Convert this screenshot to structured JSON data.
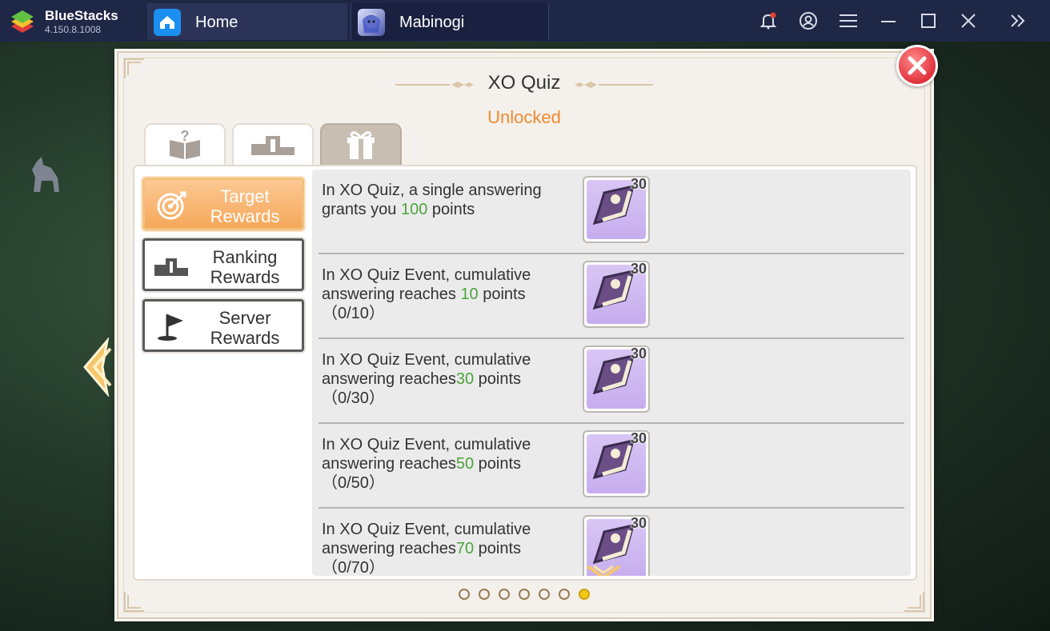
{
  "app": {
    "name": "BlueStacks",
    "version": "4.150.8.1008"
  },
  "tabs": [
    {
      "label": "Home",
      "icon": "home-icon"
    },
    {
      "label": "Mabinogi",
      "icon": "mabinogi-game-icon"
    }
  ],
  "titlebar_icons": [
    "notification-bell-icon",
    "account-icon",
    "menu-icon",
    "minimize-icon",
    "maximize-icon",
    "close-icon",
    "expand-sidebar-icon"
  ],
  "dialog": {
    "title": "XO Quiz",
    "subtitle": "Unlocked",
    "tabs": [
      {
        "icon": "quiz-book-icon",
        "active": false
      },
      {
        "icon": "podium-icon",
        "active": false
      },
      {
        "icon": "gift-box-icon",
        "active": true
      }
    ],
    "side_menu": [
      {
        "line1": "Target",
        "line2": "Rewards",
        "icon": "target-icon",
        "active": true
      },
      {
        "line1": "Ranking",
        "line2": "Rewards",
        "icon": "podium-icon",
        "active": false
      },
      {
        "line1": "Server",
        "line2": "Rewards",
        "icon": "flag-icon",
        "active": false
      }
    ],
    "rewards": [
      {
        "pre": "In XO Quiz, a single answering grants you ",
        "num": "100",
        "post": " points",
        "count": "30"
      },
      {
        "pre": "In XO Quiz Event, cumulative answering reaches ",
        "num": "10",
        "post": " points （0/10）",
        "count": "30"
      },
      {
        "pre": "In XO Quiz Event, cumulative answering reaches",
        "num": "30",
        "post": " points （0/30）",
        "count": "30"
      },
      {
        "pre": "In XO Quiz Event, cumulative answering reaches",
        "num": "50",
        "post": " points （0/50）",
        "count": "30"
      },
      {
        "pre": "In XO Quiz Event, cumulative answering reaches",
        "num": "70",
        "post": " points （0/70）",
        "count": "30"
      }
    ],
    "pagination": {
      "total": 7,
      "active_index": 6
    }
  },
  "colors": {
    "accent_orange": "#f08a30",
    "number_green": "#4ca33c",
    "titlebar": "#1f2746",
    "active_dot": "#f1c918"
  }
}
